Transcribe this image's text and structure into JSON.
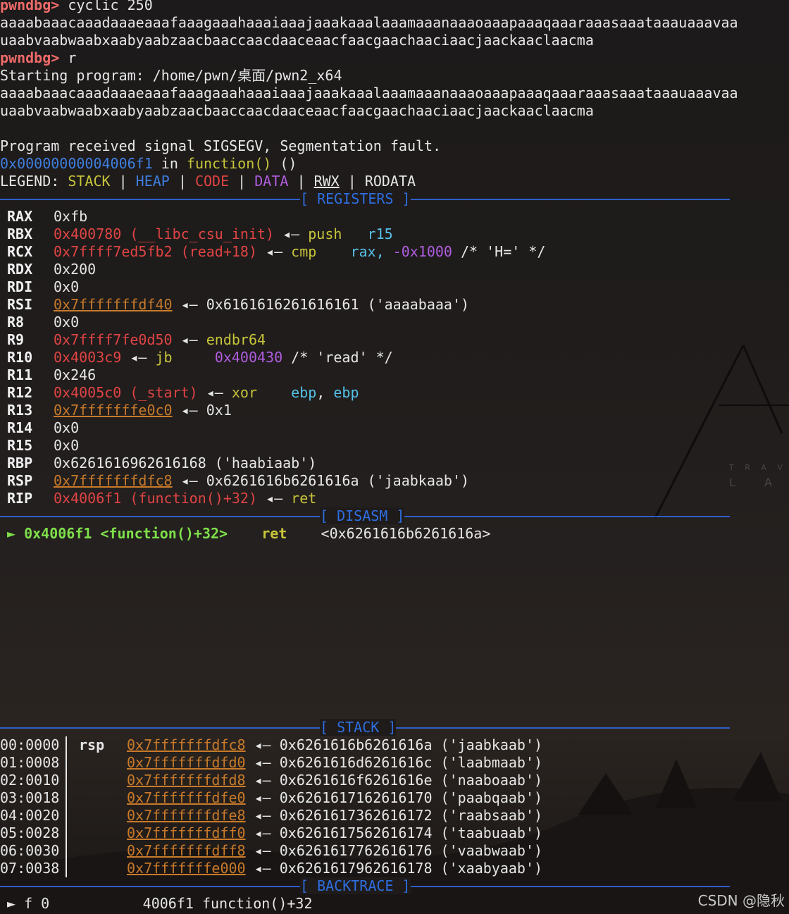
{
  "terminal": {
    "prompt": "pwndbg>",
    "cmd1": " cyclic 250",
    "cyclic_out_1": "aaaabaaacaaadaaaeaaafaaagaaahaaaiaaajaaakaaalaaamaaanaaaoaaapaaaqaaaraaasaaataaauaaavaa",
    "cyclic_out_2": "uaabvaabwaabxaabyaabzaacbaaccaacdaaceaacfaacgaachaaciaacjaackaaclaacma",
    "cmd2": " r",
    "starting": "Starting program: /home/pwn/桌面/pwn2_x64",
    "input_1": "aaaabaaacaaadaaaeaaafaaagaaahaaaiaaajaaakaaalaaamaaanaaaoaaapaaaqaaaraaasaaataaauaaavaa",
    "input_2": "uaabvaabwaabxaabyaabzaacbaaccaacdaaceaacfaacgaachaaciaacjaackaaclaacma",
    "signal": "Program received signal SIGSEGV, Segmentation fault.",
    "fault_addr": "0x00000000004006f1",
    "fault_in": " in ",
    "fault_func": "function()",
    "fault_parens": " ()",
    "legend": {
      "prefix": "LEGEND: ",
      "stack": "STACK",
      "heap": "HEAP",
      "code": "CODE",
      "data": "DATA",
      "rwx": "RWX",
      "rodata": "RODATA",
      "sep": " | "
    }
  },
  "sections": {
    "registers": "[ REGISTERS ]",
    "disasm": "[ DISASM ]",
    "stack": "[ STACK ]",
    "backtrace": "[ BACKTRACE ]"
  },
  "registers": [
    {
      "name": "RAX",
      "value": "0xfb"
    },
    {
      "name": "RBX",
      "addr": "0x400780",
      "sym": " (__libc_csu_init)",
      "arrow": " ◂— ",
      "op": "push",
      "args": "   r15"
    },
    {
      "name": "RCX",
      "addr": "0x7ffff7ed5fb2",
      "sym": " (read+18)",
      "arrow": " ◂— ",
      "op": "cmp",
      "args1": "    rax, ",
      "args2": "-0x1000",
      "comment": " /* 'H=' */"
    },
    {
      "name": "RDX",
      "value": "0x200"
    },
    {
      "name": "RDI",
      "value": "0x0"
    },
    {
      "name": "RSI",
      "addr": "0x7fffffffdf40",
      "arrow": " ◂— ",
      "val": "0x6161616261616161 ('aaaabaaa')"
    },
    {
      "name": "R8",
      "value": "0x0"
    },
    {
      "name": "R9",
      "addr": "0x7ffff7fe0d50",
      "arrow": " ◂— ",
      "op": "endbr64"
    },
    {
      "name": "R10",
      "addr": "0x4003c9",
      "arrow": " ◂— ",
      "op": "jb",
      "target": "0x400430",
      "comment": " /* 'read' */"
    },
    {
      "name": "R11",
      "value": "0x246"
    },
    {
      "name": "R12",
      "addr": "0x4005c0",
      "sym": " (_start)",
      "arrow": " ◂— ",
      "op": "xor",
      "args1": "    ebp",
      "args2": ", ",
      "args3": "ebp"
    },
    {
      "name": "R13",
      "addr": "0x7fffffffe0c0",
      "arrow": " ◂— ",
      "val": "0x1"
    },
    {
      "name": "R14",
      "value": "0x0"
    },
    {
      "name": "R15",
      "value": "0x0"
    },
    {
      "name": "RBP",
      "value": "0x6261616962616168 ('haabiaab')"
    },
    {
      "name": "RSP",
      "addr": "0x7fffffffdfc8",
      "arrow": " ◂— ",
      "val": "0x6261616b6261616a ('jaabkaab')"
    },
    {
      "name": "RIP",
      "addr": "0x4006f1",
      "sym": " (function()+32)",
      "arrow": " ◂— ",
      "op": "ret"
    }
  ],
  "disasm": {
    "marker": "► ",
    "addr": "0x4006f1",
    "sym": " <function()+32>",
    "op": "ret",
    "target": "<0x6261616b6261616a>"
  },
  "stack": [
    {
      "idx": "00:0000",
      "tag": "rsp",
      "addr": "0x7fffffffdfc8",
      "val": "0x6261616b6261616a ('jaabkaab')"
    },
    {
      "idx": "01:0008",
      "tag": "",
      "addr": "0x7fffffffdfd0",
      "val": "0x6261616d6261616c ('laabmaab')"
    },
    {
      "idx": "02:0010",
      "tag": "",
      "addr": "0x7fffffffdfd8",
      "val": "0x6261616f6261616e ('naaboaab')"
    },
    {
      "idx": "03:0018",
      "tag": "",
      "addr": "0x7fffffffdfe0",
      "val": "0x6261617162616170 ('paabqaab')"
    },
    {
      "idx": "04:0020",
      "tag": "",
      "addr": "0x7fffffffdfe8",
      "val": "0x6261617362616172 ('raabsaab')"
    },
    {
      "idx": "05:0028",
      "tag": "",
      "addr": "0x7fffffffdff0",
      "val": "0x6261617562616174 ('taabuaab')"
    },
    {
      "idx": "06:0030",
      "tag": "",
      "addr": "0x7fffffffdff8",
      "val": "0x6261617762616176 ('vaabwaab')"
    },
    {
      "idx": "07:0038",
      "tag": "",
      "addr": "0x7fffffffe000",
      "val": "0x6261617962616178 ('xaabyaab')"
    }
  ],
  "arrow": " ◂— ",
  "backtrace": {
    "marker": "► ",
    "frame": "f 0",
    "addr": "4006f1",
    "sym": "function()+32"
  },
  "watermark": "CSDN @隐秋",
  "colors": {
    "prompt": "#ee6a6a",
    "separator": "#2e5ec8",
    "address_red": "#e04444",
    "address_orange": "#c87a2a"
  }
}
